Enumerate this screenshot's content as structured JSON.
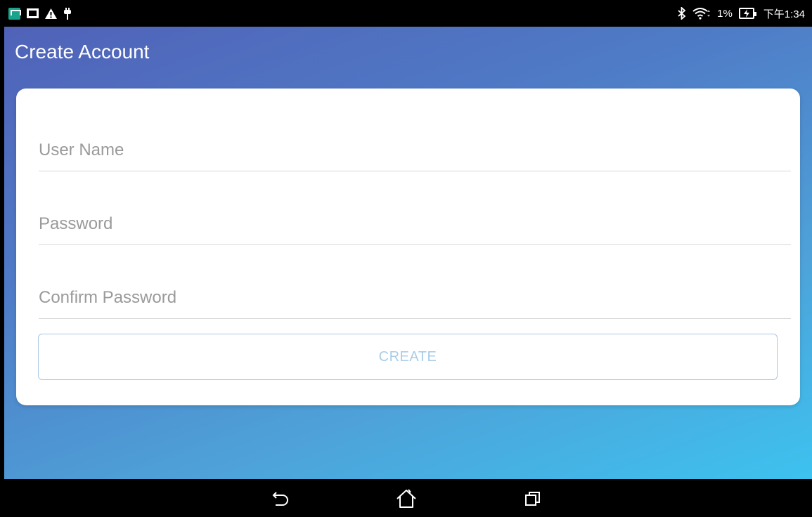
{
  "status_bar": {
    "left_icons": [
      "app-notification-icon",
      "picture-icon",
      "warning-icon",
      "usb-plug-icon"
    ],
    "right_icons": [
      "bluetooth-icon",
      "wifi-icon",
      "battery-charging-icon"
    ],
    "battery_percent": "1%",
    "time": "下午1:34"
  },
  "header": {
    "title": "Create Account"
  },
  "form": {
    "username": {
      "value": "",
      "placeholder": "User Name"
    },
    "password": {
      "value": "",
      "placeholder": "Password"
    },
    "confirm_password": {
      "value": "",
      "placeholder": "Confirm Password"
    },
    "create_label": "CREATE"
  },
  "nav_bar": {
    "buttons": [
      "back-icon",
      "home-icon",
      "recents-icon"
    ]
  },
  "colors": {
    "gradient_start": "#5062b8",
    "gradient_end": "#3dc2ef",
    "button_text": "#a9cde8",
    "placeholder": "#9a9a9a"
  }
}
